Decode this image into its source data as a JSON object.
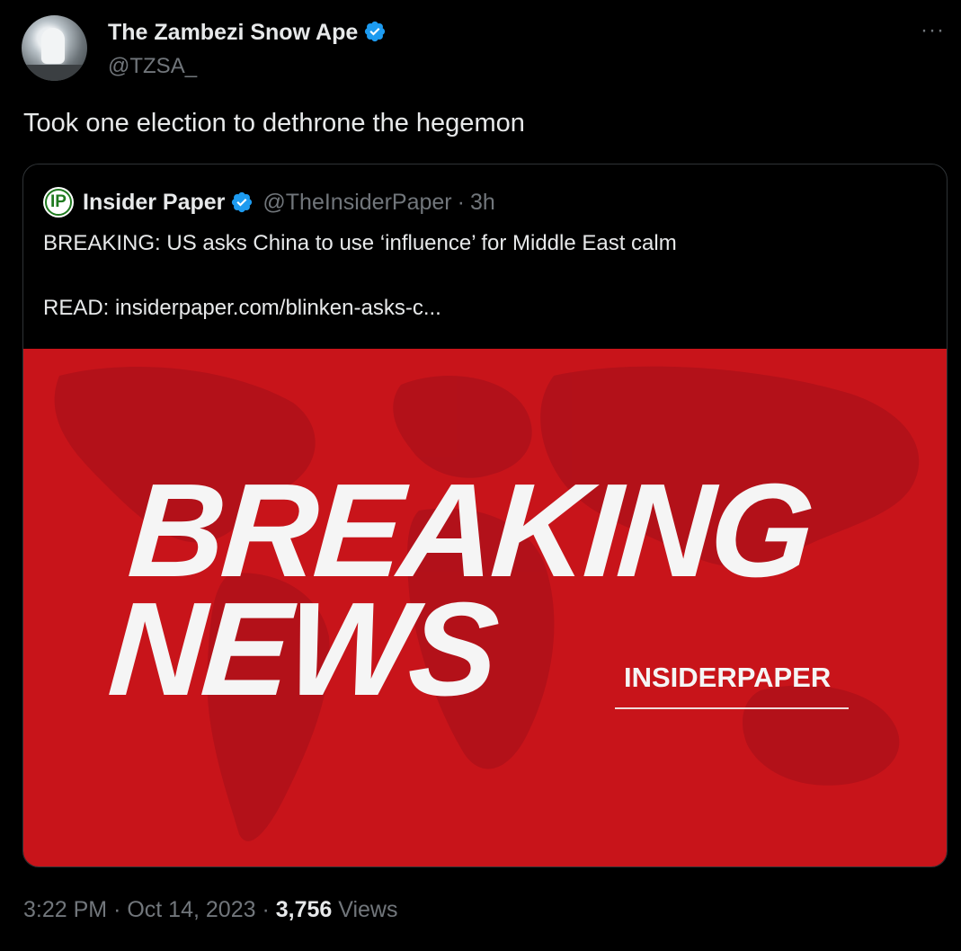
{
  "author": {
    "display_name": "The Zambezi Snow Ape",
    "handle": "@TZSA_",
    "verified": true
  },
  "more_label": "···",
  "tweet_text": "Took one election to dethrone the hegemon",
  "quoted": {
    "logo_text": "IP",
    "display_name": "Insider Paper",
    "handle": "@TheInsiderPaper",
    "separator": "·",
    "age": "3h",
    "text": "BREAKING: US asks China to use ‘influence’ for Middle East calm",
    "link_text": "READ: insiderpaper.com/blinken-asks-c...",
    "media": {
      "line1": "BREAKING",
      "line2": "NEWS",
      "brand": "INSIDERPAPER",
      "background": "#c8141a"
    }
  },
  "footer": {
    "time": "3:22 PM",
    "sep1": "·",
    "date": "Oct 14, 2023",
    "sep2": "·",
    "views_count": "3,756",
    "views_label": "Views"
  },
  "colors": {
    "verified_badge": "#1d9bf0",
    "muted_text": "#71767b",
    "primary_text": "#e7e9ea"
  }
}
